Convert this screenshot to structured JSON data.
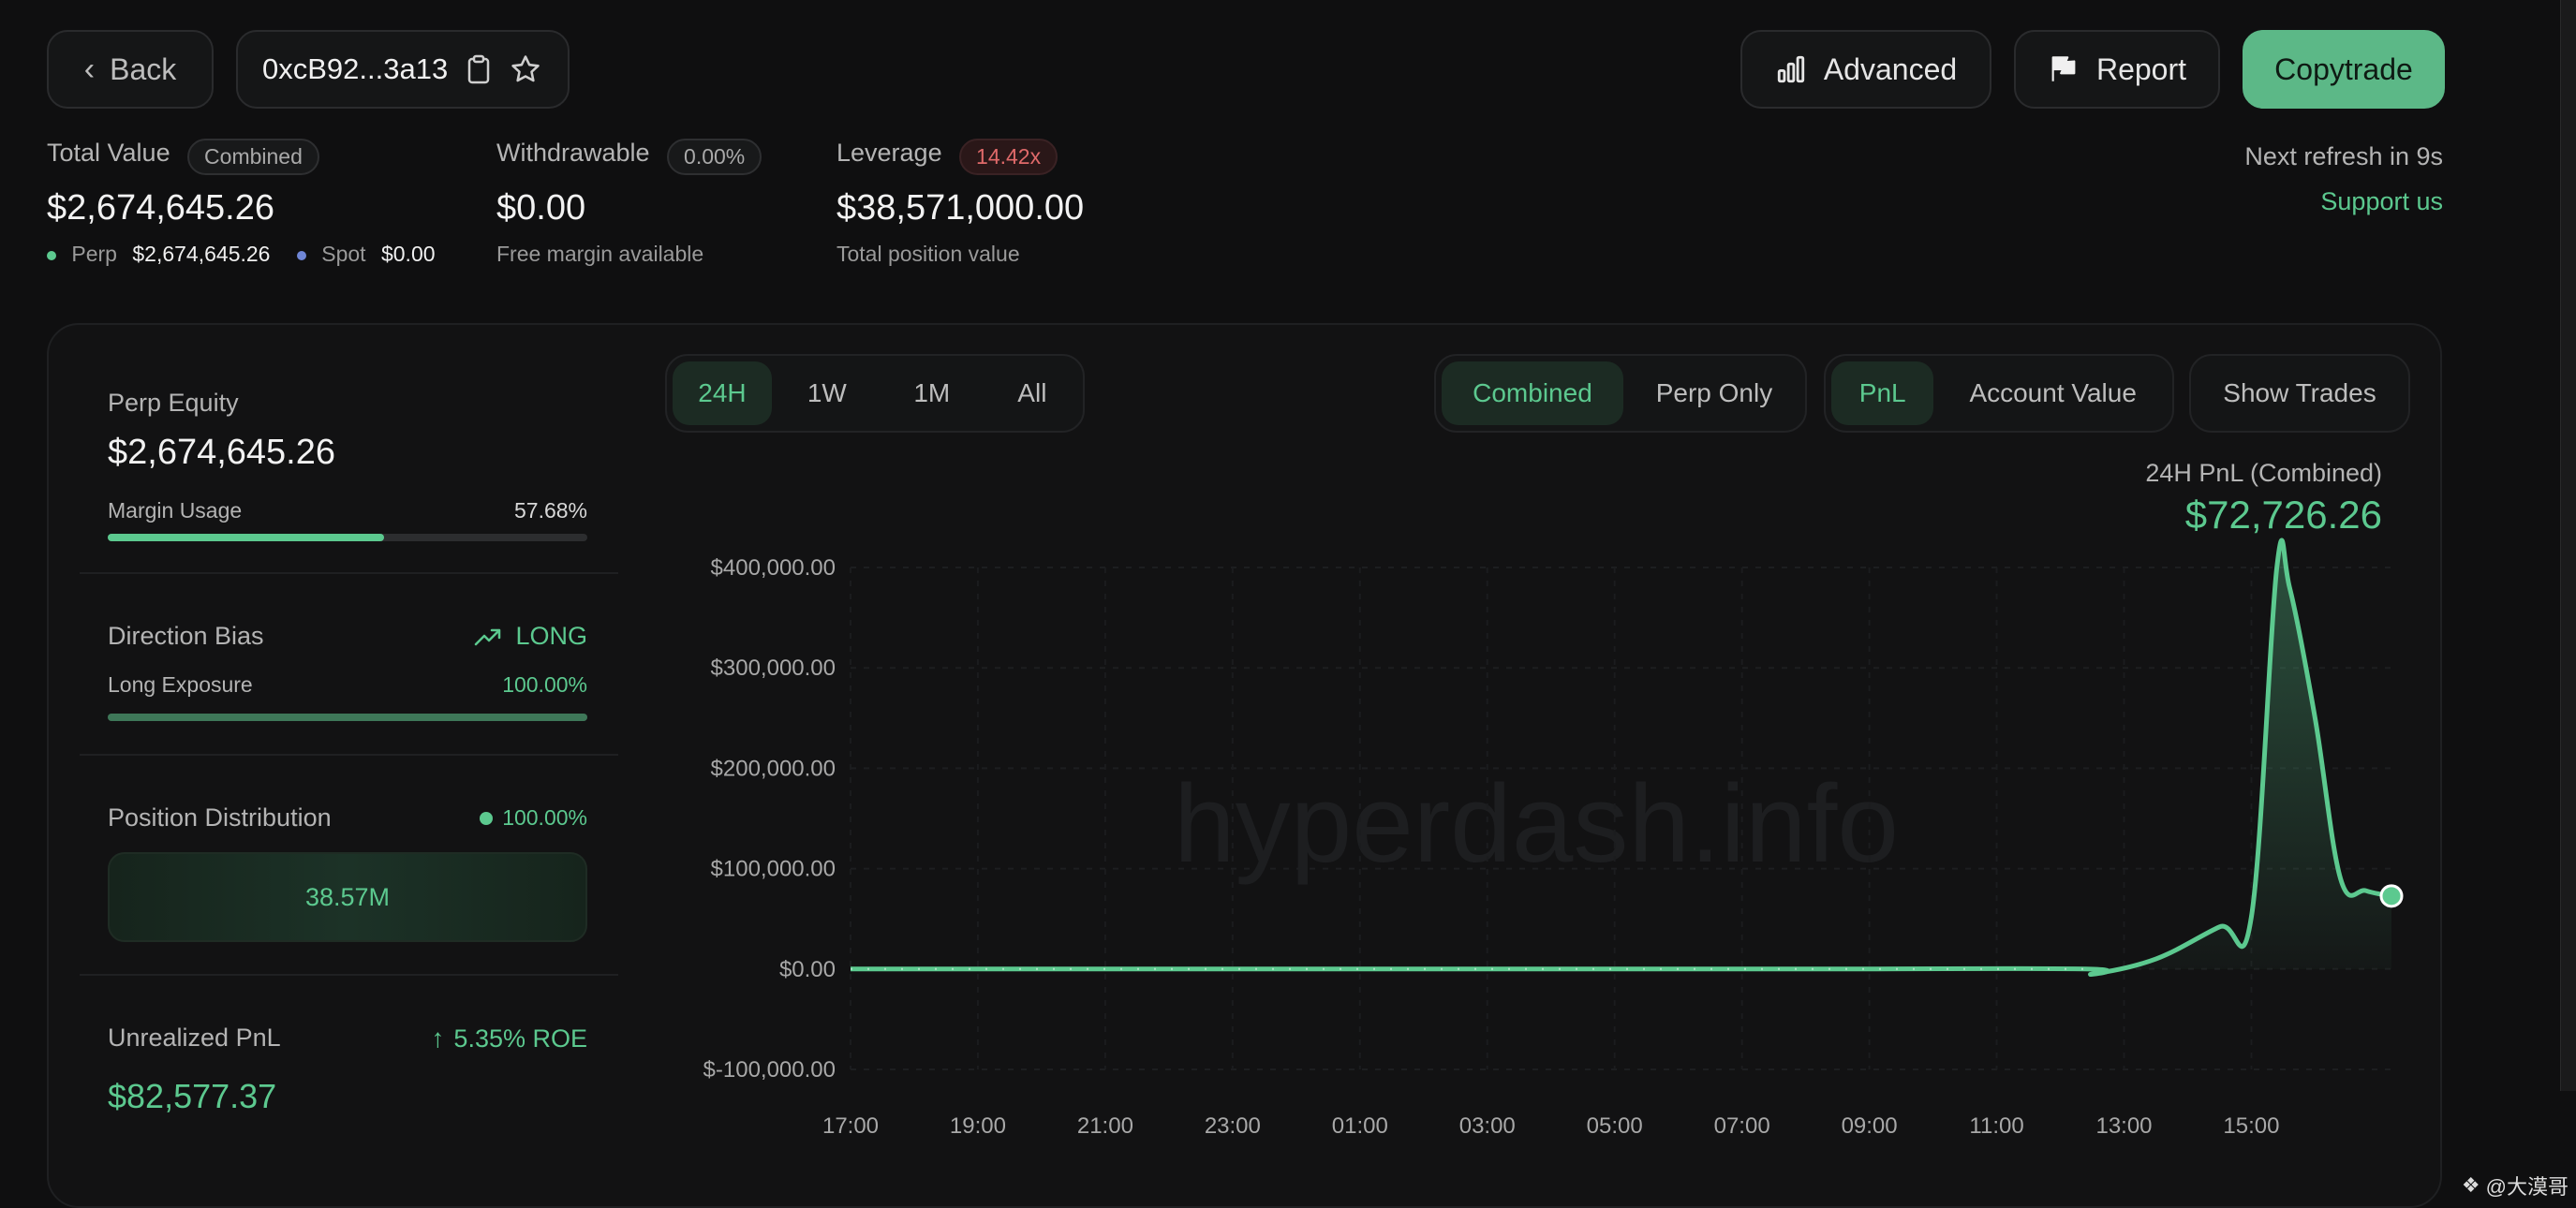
{
  "header": {
    "back_label": "Back",
    "address": "0xcB92...3a13",
    "advanced_label": "Advanced",
    "report_label": "Report",
    "copytrade_label": "Copytrade"
  },
  "summary": {
    "total_value_label": "Total Value",
    "total_value_badge": "Combined",
    "total_value": "$2,674,645.26",
    "perp_label": "Perp",
    "perp_value": "$2,674,645.26",
    "spot_label": "Spot",
    "spot_value": "$0.00",
    "withdrawable_label": "Withdrawable",
    "withdrawable_badge": "0.00%",
    "withdrawable_value": "$0.00",
    "withdrawable_sub": "Free margin available",
    "leverage_label": "Leverage",
    "leverage_badge": "14.42x",
    "leverage_value": "$38,571,000.00",
    "leverage_sub": "Total position value",
    "refresh_text": "Next refresh in 9s",
    "support_label": "Support us"
  },
  "left_panel": {
    "perp_equity_label": "Perp Equity",
    "perp_equity_value": "$2,674,645.26",
    "margin_usage_label": "Margin Usage",
    "margin_usage_value": "57.68%",
    "margin_usage_fraction": 0.5768,
    "direction_bias_label": "Direction Bias",
    "direction_bias_value": "LONG",
    "long_exposure_label": "Long Exposure",
    "long_exposure_value": "100.00%",
    "long_exposure_fraction": 1.0,
    "position_distribution_label": "Position Distribution",
    "position_distribution_value": "100.00%",
    "position_bar_value": "38.57M",
    "unrealized_pnl_label": "Unrealized PnL",
    "roe_value": "5.35% ROE",
    "unrealized_pnl_value": "$82,577.37"
  },
  "controls": {
    "time_ranges": [
      "24H",
      "1W",
      "1M",
      "All"
    ],
    "time_active": "24H",
    "scope_options": [
      "Combined",
      "Perp Only"
    ],
    "scope_active": "Combined",
    "metric_options": [
      "PnL",
      "Account Value"
    ],
    "metric_active": "PnL",
    "show_trades_label": "Show Trades"
  },
  "chart_title": "24H PnL (Combined)",
  "chart_total": "$72,726.26",
  "watermark": "hyperdash.info",
  "footer_credit": "@大漠哥",
  "colors": {
    "accent": "#5cc98f",
    "background": "#0f0f10",
    "leverage_badge": "#e06a6a"
  },
  "chart_data": {
    "type": "area",
    "title": "24H PnL (Combined)",
    "x_tick_labels": [
      "17:00",
      "19:00",
      "21:00",
      "23:00",
      "01:00",
      "03:00",
      "05:00",
      "07:00",
      "09:00",
      "11:00",
      "13:00",
      "15:00"
    ],
    "y_tick_labels": [
      "$400,000.00",
      "$300,000.00",
      "$200,000.00",
      "$100,000.00",
      "$0.00",
      "$-100,000.00"
    ],
    "y_ticks": [
      400000,
      300000,
      200000,
      100000,
      0,
      -100000
    ],
    "ylim": [
      -100000,
      400000
    ],
    "x_hours_from_start": [
      0,
      3,
      6,
      9,
      12,
      15,
      19.4,
      19.5,
      20.5,
      21.5,
      22.0,
      22.4,
      22.6,
      23.0,
      23.4,
      23.8,
      24.2
    ],
    "y": [
      0,
      0,
      0,
      0,
      0,
      0,
      0,
      -5000,
      10000,
      42000,
      52000,
      400000,
      380000,
      250000,
      90000,
      78000,
      72726.26
    ],
    "grid": true,
    "legend": "none"
  }
}
